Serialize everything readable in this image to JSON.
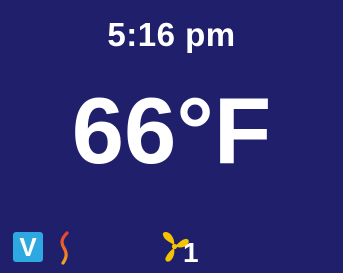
{
  "display": {
    "time": "5:16 pm",
    "temperature": "66°F"
  },
  "status": {
    "vacation_badge": "V",
    "heat_icon": "heat-wave-icon",
    "fan_icon": "fan-icon",
    "fan_speed": "1"
  },
  "colors": {
    "background": "#1f1f6c",
    "text": "#ffffff",
    "badge": "#2ea8e0",
    "heat_stroke_top": "#e8432b",
    "heat_stroke_bottom": "#f5a623",
    "fan": "#f5c400"
  }
}
